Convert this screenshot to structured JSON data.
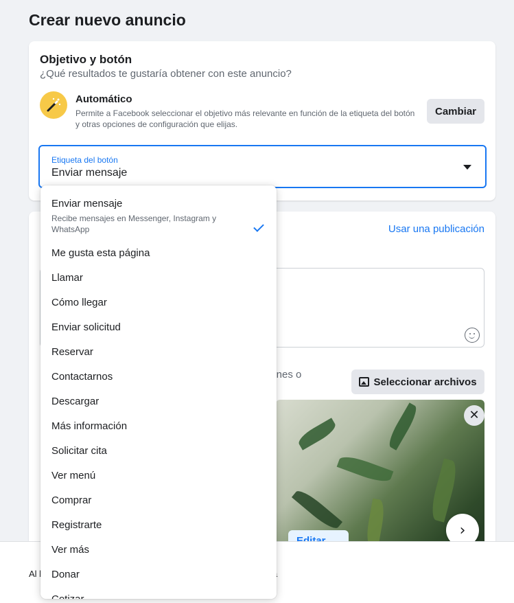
{
  "page": {
    "title": "Crear nuevo anuncio"
  },
  "objective": {
    "heading": "Objetivo y botón",
    "subheading": "¿Qué resultados te gustaría obtener con este anuncio?",
    "auto_title": "Automático",
    "auto_description": "Permite a Facebook seleccionar el objetivo más relevante en función de la etiqueta del botón y otras opciones de configuración que elijas.",
    "change_label": "Cambiar",
    "icon": "magic-wand-icon"
  },
  "button_select": {
    "label": "Etiqueta del botón",
    "value": "Enviar mensaje"
  },
  "creative": {
    "use_post_label": "Usar una publicación",
    "media_hint_partial": "genes o",
    "select_files_label": "Seleccionar archivos",
    "edit_label": "Editar",
    "remove_glyph": "✕",
    "next_glyph": "›"
  },
  "footer": {
    "left_partial": "Al l",
    "right_partial": "a"
  },
  "dropdown": {
    "options": [
      {
        "label": "Enviar mensaje",
        "description": "Recibe mensajes en Messenger, Instagram y WhatsApp",
        "selected": true
      },
      {
        "label": "Me gusta esta página"
      },
      {
        "label": "Llamar"
      },
      {
        "label": "Cómo llegar"
      },
      {
        "label": "Enviar solicitud"
      },
      {
        "label": "Reservar"
      },
      {
        "label": "Contactarnos"
      },
      {
        "label": "Descargar"
      },
      {
        "label": "Más información"
      },
      {
        "label": "Solicitar cita"
      },
      {
        "label": "Ver menú"
      },
      {
        "label": "Comprar"
      },
      {
        "label": "Registrarte"
      },
      {
        "label": "Ver más"
      },
      {
        "label": "Donar"
      },
      {
        "label": "Cotizar"
      }
    ]
  },
  "colors": {
    "accent": "#1877f2",
    "background": "#f0f2f5",
    "secondary_button": "#e4e6eb"
  }
}
